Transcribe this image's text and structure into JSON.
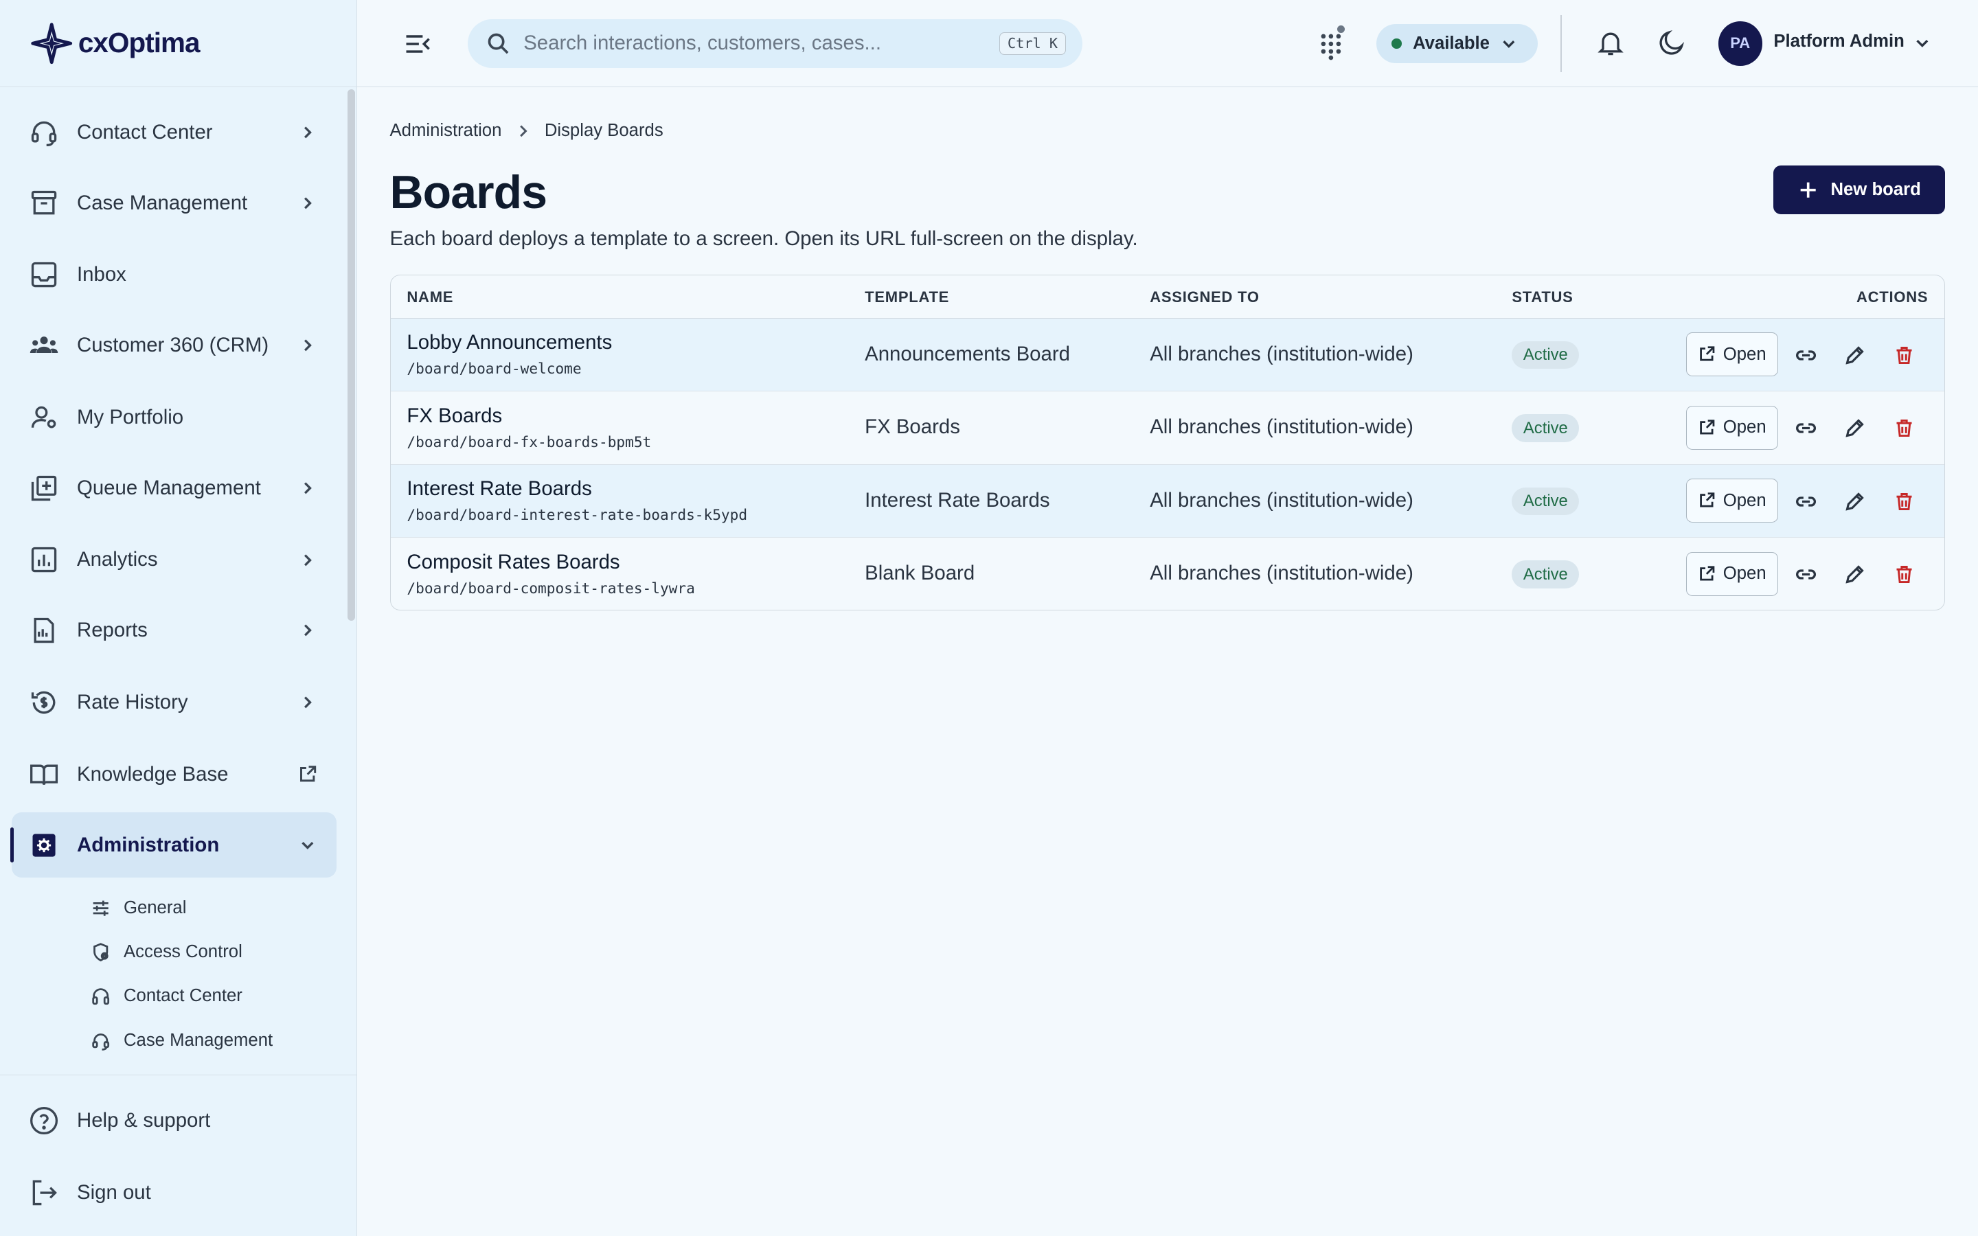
{
  "app": {
    "logo_text": "cxOptima"
  },
  "sidebar": {
    "items": [
      {
        "label": "Contact Center",
        "icon": "headset-icon",
        "has_chevron": true
      },
      {
        "label": "Case Management",
        "icon": "archive-box-icon",
        "has_chevron": true
      },
      {
        "label": "Inbox",
        "icon": "inbox-icon",
        "has_chevron": false
      },
      {
        "label": "Customer 360 (CRM)",
        "icon": "users-group-icon",
        "has_chevron": true
      },
      {
        "label": "My Portfolio",
        "icon": "user-settings-icon",
        "has_chevron": false
      },
      {
        "label": "Queue Management",
        "icon": "queue-add-icon",
        "has_chevron": true
      },
      {
        "label": "Analytics",
        "icon": "bar-chart-icon",
        "has_chevron": true
      },
      {
        "label": "Reports",
        "icon": "report-icon",
        "has_chevron": true
      },
      {
        "label": "Rate History",
        "icon": "rate-history-icon",
        "has_chevron": true
      },
      {
        "label": "Knowledge Base",
        "icon": "book-icon",
        "has_chevron": false,
        "external": true
      },
      {
        "label": "Administration",
        "icon": "admin-gear-icon",
        "active": true,
        "expanded": true
      }
    ],
    "sub_items": [
      {
        "label": "General",
        "icon": "sliders-icon"
      },
      {
        "label": "Access Control",
        "icon": "shield-lock-icon"
      },
      {
        "label": "Contact Center",
        "icon": "headphones-icon"
      },
      {
        "label": "Case Management",
        "icon": "headset-small-icon"
      }
    ],
    "footer": {
      "help_label": "Help & support",
      "signout_label": "Sign out"
    }
  },
  "header": {
    "search_placeholder": "Search interactions, customers, cases...",
    "search_shortcut": "Ctrl K",
    "status_label": "Available",
    "status_color": "#1f7a4c",
    "user_initials": "PA",
    "user_name": "Platform Admin"
  },
  "main": {
    "breadcrumb": [
      "Administration",
      "Display Boards"
    ],
    "title": "Boards",
    "description": "Each board deploys a template to a screen. Open its URL full-screen on the display.",
    "new_button_label": "New board",
    "table": {
      "columns": [
        "NAME",
        "TEMPLATE",
        "ASSIGNED TO",
        "STATUS",
        "ACTIONS"
      ],
      "open_label": "Open",
      "rows": [
        {
          "name": "Lobby Announcements",
          "path": "/board/board-welcome",
          "template": "Announcements Board",
          "assigned": "All branches (institution-wide)",
          "status": "Active"
        },
        {
          "name": "FX Boards",
          "path": "/board/board-fx-boards-bpm5t",
          "template": "FX Boards",
          "assigned": "All branches (institution-wide)",
          "status": "Active"
        },
        {
          "name": "Interest Rate Boards",
          "path": "/board/board-interest-rate-boards-k5ypd",
          "template": "Interest Rate Boards",
          "assigned": "All branches (institution-wide)",
          "status": "Active"
        },
        {
          "name": "Composit Rates Boards",
          "path": "/board/board-composit-rates-lywra",
          "template": "Blank Board",
          "assigned": "All branches (institution-wide)",
          "status": "Active"
        }
      ]
    }
  },
  "colors": {
    "brand_navy": "#14184e",
    "status_active_text": "#1f6b45",
    "danger": "#c62828"
  }
}
